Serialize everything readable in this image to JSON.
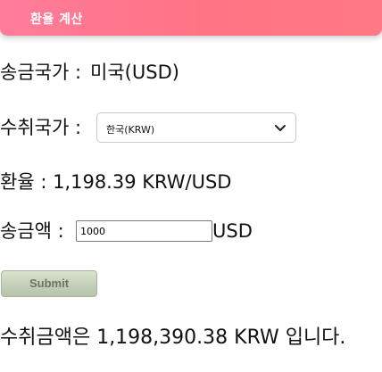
{
  "header": {
    "title": "환율 계산",
    "color": "#ff7384"
  },
  "sending_country": {
    "label": "송금국가 :",
    "value": "미국(USD)"
  },
  "receiving_country": {
    "label": "수취국가 :",
    "selected": "한국(KRW)",
    "icon": "chevron-down-icon"
  },
  "exchange_rate": {
    "text": "환율 : 1,198.39 KRW/USD"
  },
  "amount": {
    "label": "송금액 :",
    "value": "1000",
    "unit": "USD"
  },
  "submit": {
    "label": "Submit"
  },
  "result": {
    "text": "수취금액은 1,198,390.38 KRW 입니다."
  }
}
